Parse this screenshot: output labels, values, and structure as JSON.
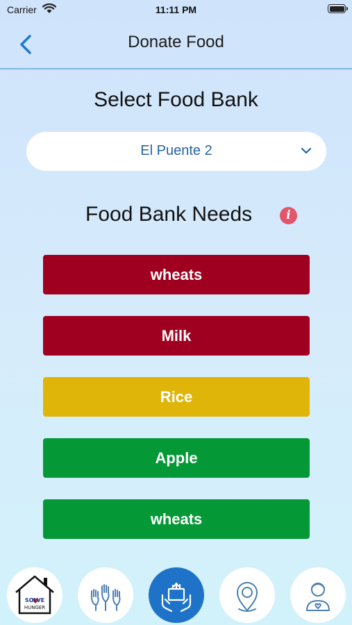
{
  "status_bar": {
    "carrier": "Carrier",
    "time": "11:11 PM"
  },
  "nav": {
    "title": "Donate Food"
  },
  "select_food_bank": {
    "title": "Select Food Bank",
    "selected": "El Puente 2"
  },
  "needs": {
    "title": "Food Bank Needs",
    "items": [
      {
        "label": "wheats",
        "color": "#a00020"
      },
      {
        "label": "Milk",
        "color": "#a00020"
      },
      {
        "label": "Rice",
        "color": "#e0b50a"
      },
      {
        "label": "Apple",
        "color": "#049936"
      },
      {
        "label": "wheats",
        "color": "#049936"
      }
    ]
  },
  "tabbar": {
    "logo_text": [
      "SOLVE",
      "HUNGER"
    ],
    "tabs": [
      "home-logo",
      "volunteer-hands",
      "donate-food",
      "location-pin",
      "profile"
    ],
    "active_tab": "donate-food",
    "accent": "#1e73c8"
  }
}
